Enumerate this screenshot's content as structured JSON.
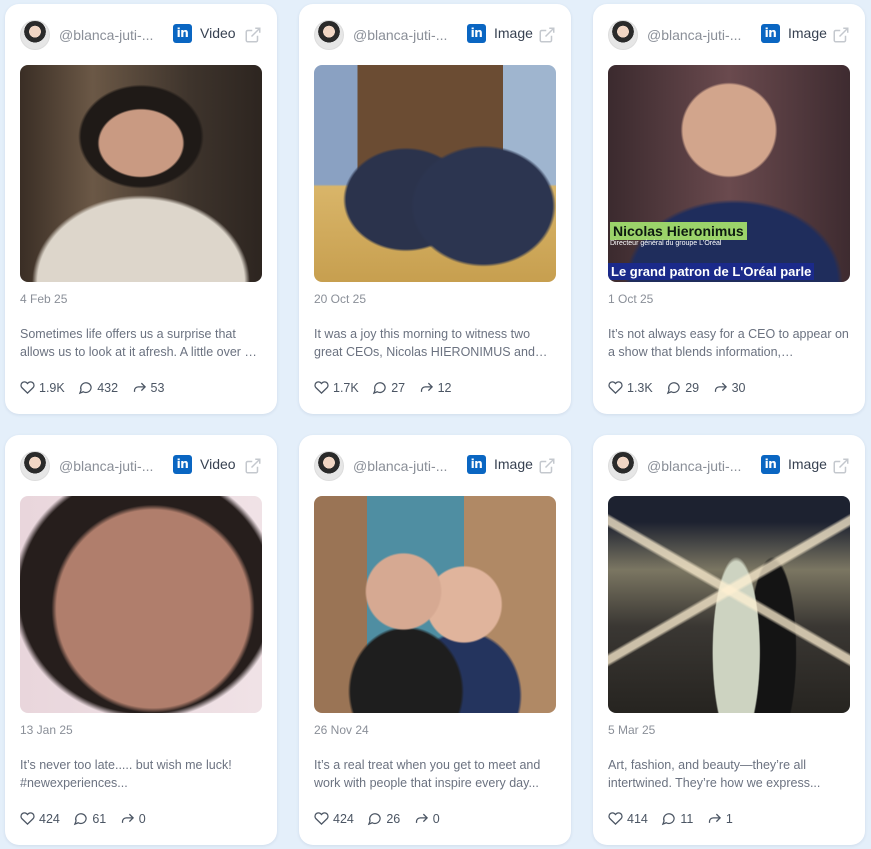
{
  "cards": [
    {
      "handle": "@blanca-juti-...",
      "type": "Video",
      "date": "4 Feb 25",
      "text": "Sometimes life offers us a surprise that allows us to look at it afresh. A little over a year ago...",
      "likes": "1.9K",
      "comments": "432",
      "shares": "53"
    },
    {
      "handle": "@blanca-juti-...",
      "type": "Image",
      "date": "20 Oct 25",
      "text": "It was a joy this morning to witness two great CEOs, Nicolas HIERONIMUS and Luca de Meo...",
      "likes": "1.7K",
      "comments": "27",
      "shares": "12"
    },
    {
      "handle": "@blanca-juti-...",
      "type": "Image",
      "date": "1 Oct 25",
      "text": "It’s not always easy for a CEO to appear on a show that blends information, entertainment...",
      "likes": "1.3K",
      "comments": "29",
      "shares": "30",
      "overlay": {
        "name": "Nicolas Hieronimus",
        "subtitle": "Directeur général du groupe L'Oréal",
        "tag": "Le grand patron de L'Oréal parle"
      }
    },
    {
      "handle": "@blanca-juti-...",
      "type": "Video",
      "date": "13 Jan 25",
      "text": "It’s never too late..... but wish me luck! #newexperiences...",
      "likes": "424",
      "comments": "61",
      "shares": "0"
    },
    {
      "handle": "@blanca-juti-...",
      "type": "Image",
      "date": "26 Nov 24",
      "text": "It’s a real treat when you get to meet and work with people that inspire every day...",
      "likes": "424",
      "comments": "26",
      "shares": "0"
    },
    {
      "handle": "@blanca-juti-...",
      "type": "Image",
      "date": "5 Mar 25",
      "text": "Art, fashion, and beauty—they’re all intertwined.   They’re how we express...",
      "likes": "414",
      "comments": "11",
      "shares": "1"
    }
  ],
  "icons": {
    "platform": "linkedin-icon",
    "external": "external-link-icon",
    "like": "heart-icon",
    "comment": "comment-icon",
    "share": "share-icon"
  },
  "colors": {
    "linkedin": "#0a66c2",
    "background": "#e4effa",
    "card": "#ffffff"
  }
}
